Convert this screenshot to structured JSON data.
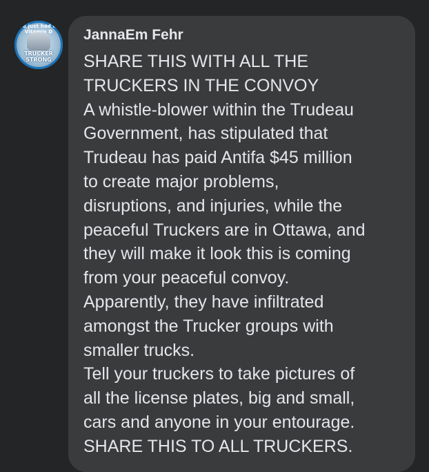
{
  "comment": {
    "avatar": {
      "ring_text": "You just had my Vitamin D",
      "badge_text": "TRUCKER STRONG"
    },
    "author": "JannaEm Fehr",
    "lines": [
      "SHARE THIS WITH ALL THE",
      "TRUCKERS IN THE CONVOY",
      "A whistle-blower within the Trudeau",
      "Government, has stipulated that",
      "Trudeau has paid Antifa $45 million",
      "to create major problems,",
      "disruptions, and injuries, while the",
      "peaceful Truckers are in Ottawa, and",
      "they will make it look this is coming",
      "from your peaceful convoy.",
      "Apparently, they have infiltrated",
      "amongst the Trucker groups with",
      "smaller trucks.",
      "Tell your truckers to take pictures of",
      "all the license plates, big and small,",
      "cars and anyone in your entourage.",
      "SHARE THIS TO ALL TRUCKERS."
    ]
  },
  "colors": {
    "background": "#242526",
    "bubble": "#3a3b3c",
    "text": "#e4e6eb",
    "avatar_ring": "#1a73b8"
  }
}
